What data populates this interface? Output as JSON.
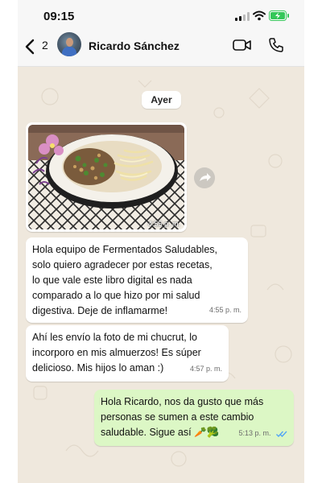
{
  "status_bar": {
    "time": "09:15"
  },
  "header": {
    "back_count": "2",
    "contact_name": "Ricardo Sánchez",
    "icons": [
      "chevron-left-icon",
      "video-call-icon",
      "phone-icon"
    ]
  },
  "chat": {
    "day_label": "Ayer",
    "photo_message": {
      "time": "4:55 p. m."
    },
    "messages": [
      {
        "direction": "incoming",
        "text": "Hola equipo de Fermentados Saludables,\nsolo quiero agradecer por estas recetas,\nlo que vale este libro digital es nada\ncomparado a lo que hizo por mi salud\ndigestiva. Deje de inflamarme!",
        "time": "4:55 p. m."
      },
      {
        "direction": "incoming",
        "text": "Ahí les envío la foto de mi chucrut, lo\nincorporo en mis almuerzos! Es súper\ndelicioso. Mis hijos lo aman :)",
        "time": "4:57 p. m."
      },
      {
        "direction": "outgoing",
        "text": "Hola Ricardo, nos da gusto que más\npersonas se sumen a este cambio\nsaludable. Sigue así 🥕🥦",
        "time": "5:13 p. m.",
        "read": true
      }
    ]
  },
  "colors": {
    "chat_background": "#efe8dd",
    "outgoing_bubble": "#dcf7c5",
    "incoming_bubble": "#ffffff",
    "read_ticks": "#4fa3f7",
    "battery": "#34c759"
  }
}
